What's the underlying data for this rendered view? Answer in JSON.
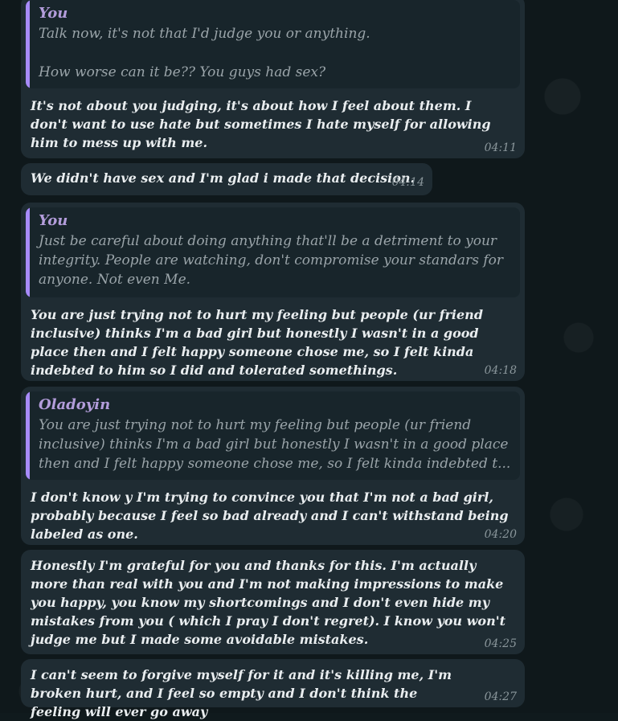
{
  "messages": [
    {
      "quote_author": "You",
      "quote_text": "Talk now, it's not that I'd judge you or anything.\n\nHow worse can it be?? You guys had sex?",
      "text": "It's not about you judging, it's about how I feel about them. I don't want to use hate but sometimes I hate myself for allowing him to mess up with me.",
      "time": "04:11"
    },
    {
      "text": "We didn't have sex and I'm glad i made that decision.",
      "time": "04:14"
    },
    {
      "quote_author": "You",
      "quote_text": "Just be careful about doing anything that'll be a detriment to your integrity. People are watching, don't compromise your standars for anyone. Not even Me.",
      "text": "You are just trying not to hurt my feeling but people (ur friend inclusive) thinks I'm a bad girl but honestly I wasn't in a good place then and I felt happy someone chose me, so I felt kinda indebted to him so I did and tolerated somethings.",
      "time": "04:18"
    },
    {
      "quote_author": "Oladoyin",
      "quote_text": "You are just trying not to hurt my feeling but people (ur friend inclusive) thinks I'm a bad girl but honestly I wasn't in a good place then and I felt happy someone chose me, so I felt kinda indebted t...",
      "text": "I don't know y I'm trying to convince you that I'm not a bad girl, probably because I feel so bad already and I can't withstand being labeled as one.",
      "time": "04:20"
    },
    {
      "text": "Honestly I'm grateful for you and thanks for this. I'm actually more than real with you and I'm not making impressions to make you happy, you know my shortcomings and I don't even hide my\n mistakes from you ( which I pray I don't regret). I know you won't judge me but I made some avoidable mistakes.",
      "time": "04:25"
    },
    {
      "text": "I can't seem to forgive myself for it and it's killing me, I'm broken  hurt, and I feel so empty and I don't think the feeling will ever go away",
      "time": "04:27"
    }
  ]
}
